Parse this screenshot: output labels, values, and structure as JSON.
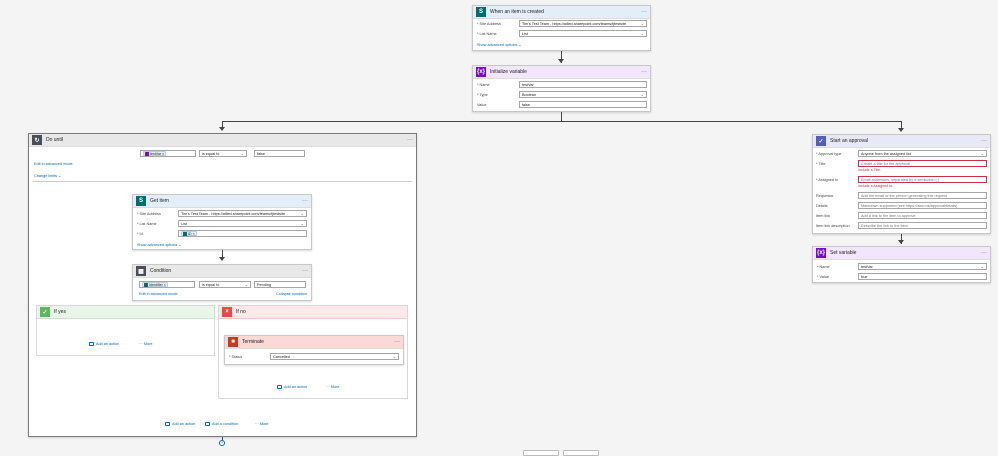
{
  "trigger": {
    "title": "When an item is created",
    "site_label": "* Site Address",
    "site_value": "Tim's Test Team - https://allied.sharepoint.com/teams/tjtestsite",
    "list_label": "* List Name",
    "list_value": "List",
    "show_advanced": "Show advanced options",
    "menu": "···"
  },
  "init_var": {
    "title": "Initialize variable",
    "name_label": "* Name",
    "name_value": "testVar",
    "type_label": "* Type",
    "type_value": "Boolean",
    "value_label": "Value",
    "value_value": "false",
    "menu": "···"
  },
  "do_until": {
    "title": "Do until",
    "token": "testVar",
    "operator": "is equal to",
    "compare_value": "false",
    "edit_advanced": "Edit in advanced mode",
    "change_limits": "Change limits",
    "menu": "···",
    "add_action": "Add an action",
    "add_condition": "Add a condition",
    "more": "More"
  },
  "get_item": {
    "title": "Get item",
    "site_label": "* Site Address",
    "site_value": "Tim's Test Team - https://allied.sharepoint.com/teams/tjtestsite",
    "list_label": "* List Name",
    "list_value": "List",
    "id_label": "* Id",
    "id_token": "ID",
    "show_advanced": "Show advanced options",
    "menu": "···"
  },
  "condition": {
    "title": "Condition",
    "token": "Identifier",
    "operator": "is equal to",
    "value": "Pending",
    "edit_advanced": "Edit in advanced mode",
    "collapse": "Collapse condition",
    "menu": "···"
  },
  "if_yes": {
    "title": "If yes",
    "add_action": "Add an action",
    "more": "More"
  },
  "if_no": {
    "title": "If no",
    "add_action": "Add an action",
    "more": "More"
  },
  "terminate": {
    "title": "Terminate",
    "status_label": "* Status",
    "status_value": "Cancelled",
    "menu": "···"
  },
  "approval": {
    "title": "Start an approval",
    "type_label": "* Approval type",
    "type_value": "Anyone from the assigned list",
    "title_label": "* Title",
    "title_placeholder": "Create a title for the approval",
    "title_error": "Include a Title.",
    "assigned_label": "* Assigned to",
    "assigned_placeholder": "Email addresses, separated by a semicolon (;)",
    "assigned_error": "Include a Assigned to.",
    "requestor_label": "Requestor",
    "requestor_placeholder": "Add the email of the person generating this request",
    "details_label": "Details",
    "details_placeholder": "Markdown supported (see https://aka.ms/approvaldetails)",
    "link_label": "Item link",
    "link_placeholder": "Add a link to the item to approve",
    "linkdesc_label": "Item link description",
    "linkdesc_placeholder": "Describe the link to the item",
    "menu": "···"
  },
  "set_var": {
    "title": "Set variable",
    "name_label": "* Name",
    "name_value": "testVar",
    "value_label": "* Value",
    "value_value": "true",
    "menu": "···"
  },
  "colors": {
    "sharepoint": "#036c70",
    "variable": "#770bd6",
    "control": "#484f58",
    "approval": "#4e5fbf",
    "terminate": "#c43e1c",
    "yes": "#5cb85c",
    "no": "#e74c3c",
    "link": "#0066bb"
  }
}
